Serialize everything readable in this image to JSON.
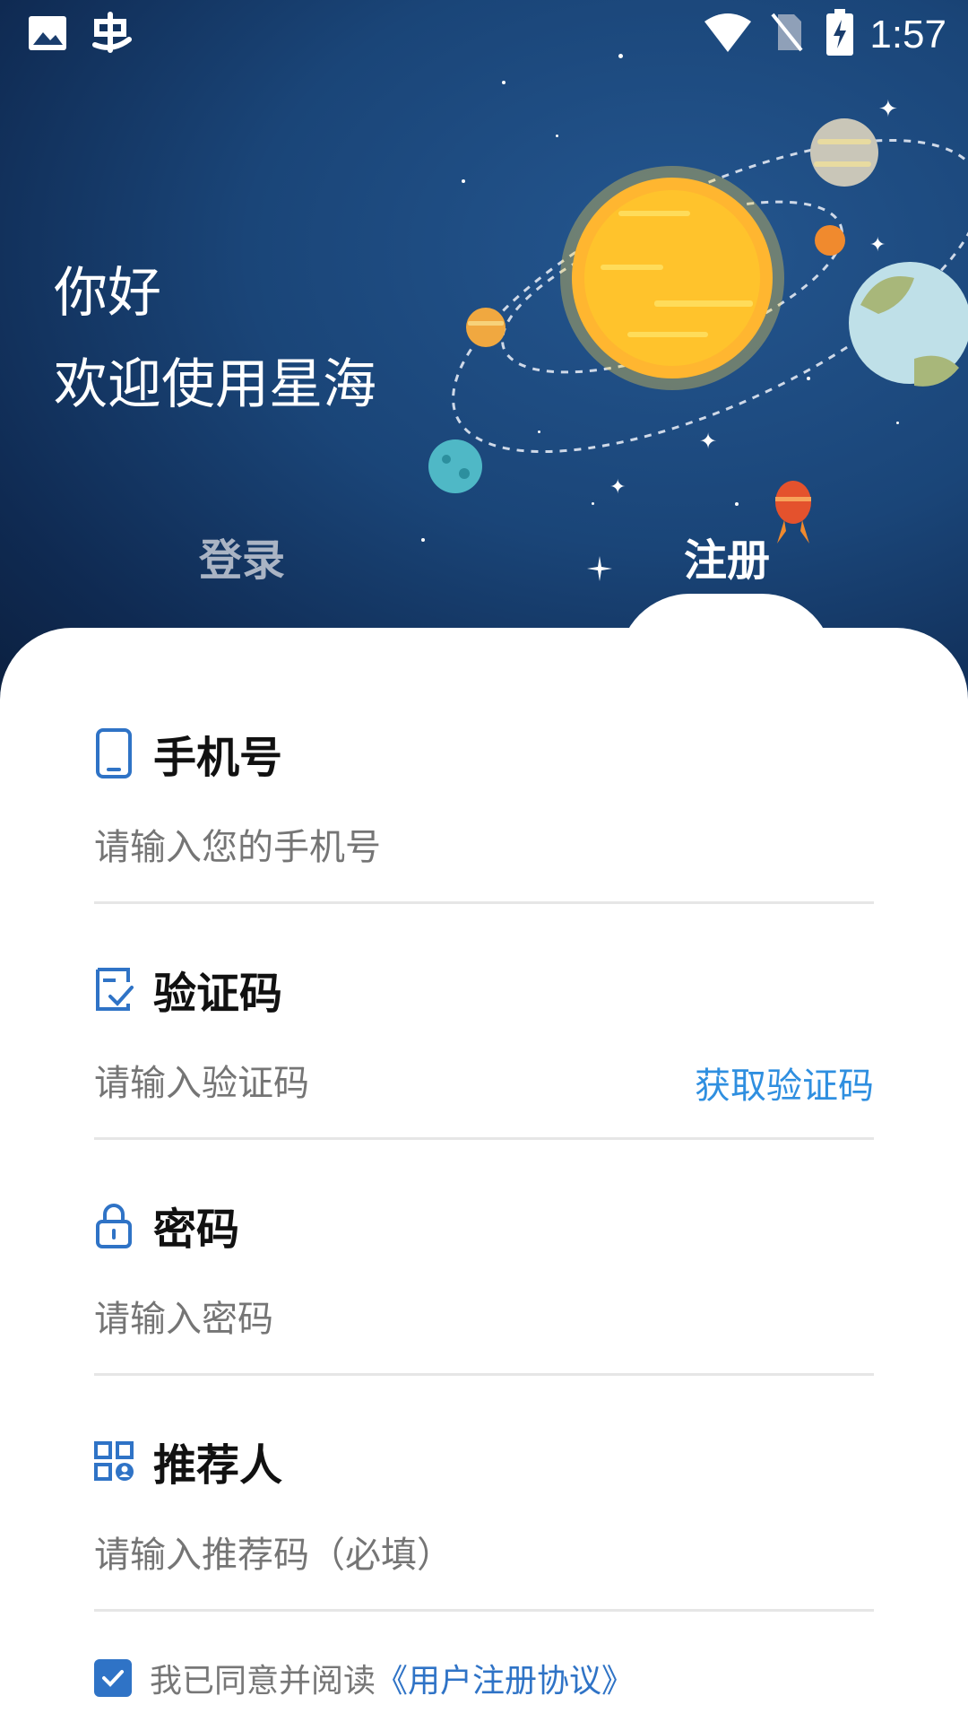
{
  "status_bar": {
    "time": "1:57",
    "icons": [
      "image-icon",
      "app-icon",
      "wifi-icon",
      "no-sim-icon",
      "battery-charging-icon"
    ]
  },
  "header": {
    "greeting": "你好",
    "welcome": "欢迎使用星海"
  },
  "tabs": [
    {
      "label": "登录",
      "active": false
    },
    {
      "label": "注册",
      "active": true
    }
  ],
  "form": {
    "phone": {
      "label": "手机号",
      "placeholder": "请输入您的手机号"
    },
    "code": {
      "label": "验证码",
      "placeholder": "请输入验证码",
      "action": "获取验证码"
    },
    "password": {
      "label": "密码",
      "placeholder": "请输入密码"
    },
    "referrer": {
      "label": "推荐人",
      "placeholder": "请输入推荐码（必填）"
    }
  },
  "agreement": {
    "checked": true,
    "text": "我已同意并阅读",
    "link": "《用户注册协议》"
  },
  "colors": {
    "accent": "#2f73c6",
    "link": "#2f8fe0",
    "hero_bg": "#1a4578"
  }
}
